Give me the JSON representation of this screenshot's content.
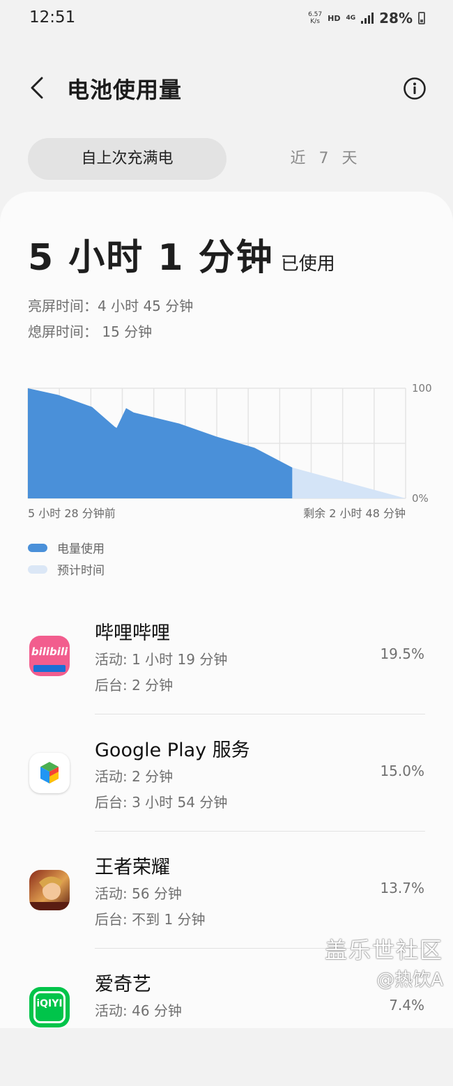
{
  "status_bar": {
    "time": "12:51",
    "speed_value": "6.57",
    "speed_unit": "K/s",
    "hd": "HD",
    "network": "4G",
    "battery_pct": "28%"
  },
  "header": {
    "title": "电池使用量",
    "back_icon": "chevron-left-icon",
    "info_icon": "info-circle-icon"
  },
  "tabs": [
    {
      "label": "自上次充满电",
      "active": true
    },
    {
      "label": "近 7 天",
      "active": false
    }
  ],
  "usage": {
    "duration": "5 小时 1 分钟",
    "suffix": "已使用",
    "screen_on": "亮屏时间：4 小时 45 分钟",
    "screen_off": "熄屏时间： 15 分钟"
  },
  "chart_data": {
    "type": "area",
    "y_ticks": [
      "100",
      "0%"
    ],
    "ylim": [
      0,
      100
    ],
    "x_start_label": "5 小时 28 分钟前",
    "x_end_label": "剩余 2 小时 48 分钟",
    "grid": true,
    "series": [
      {
        "name": "电量使用",
        "color": "#4a90d9",
        "x": [
          0,
          0.08,
          0.17,
          0.23,
          0.235,
          0.26,
          0.28,
          0.4,
          0.5,
          0.6,
          0.7
        ],
        "y": [
          100,
          94,
          83,
          65,
          64,
          82,
          78,
          68,
          56,
          46,
          28
        ]
      },
      {
        "name": "预计时间",
        "color": "#d4e4f7",
        "x": [
          0.7,
          1.0
        ],
        "y": [
          28,
          0
        ]
      }
    ]
  },
  "legend": [
    {
      "label": "电量使用",
      "color": "#4a90d9"
    },
    {
      "label": "预计时间",
      "color": "#dbe7f6"
    }
  ],
  "apps": [
    {
      "name": "哔哩哔哩",
      "active": "活动: 1 小时 19 分钟",
      "background": "后台: 2 分钟",
      "percent": "19.5%",
      "icon": "bilibili-icon",
      "icon_text": "bilibili"
    },
    {
      "name": "Google Play 服务",
      "active": "活动: 2 分钟",
      "background": "后台: 3 小时 54 分钟",
      "percent": "15.0%",
      "icon": "google-play-services-icon"
    },
    {
      "name": "王者荣耀",
      "active": "活动: 56 分钟",
      "background": "后台: 不到 1 分钟",
      "percent": "13.7%",
      "icon": "honor-of-kings-icon"
    },
    {
      "name": "爱奇艺",
      "active": "活动: 46 分钟",
      "background": "",
      "percent": "7.4%",
      "icon": "iqiyi-icon",
      "icon_text": "iQIYI"
    }
  ],
  "watermark": {
    "line1": "盖乐世社区",
    "line2": "@热饮A"
  }
}
